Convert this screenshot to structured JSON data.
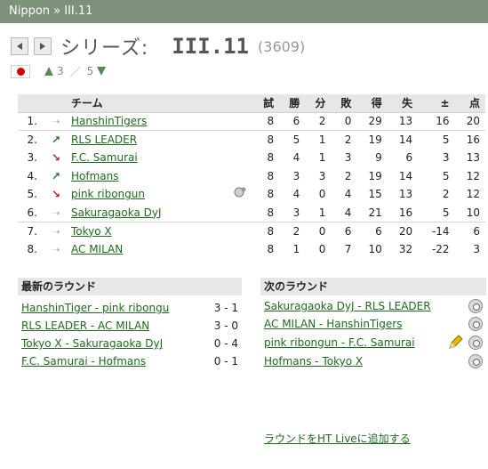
{
  "breadcrumb": "Nippon » III.11",
  "title": {
    "series": "シリーズ:",
    "league": "III.11",
    "id": "(3609)"
  },
  "subnav": {
    "up": "3",
    "sep": "／",
    "down": "5"
  },
  "table": {
    "headers": [
      "チーム",
      "試",
      "勝",
      "分",
      "敗",
      "得",
      "失",
      "±",
      "点"
    ],
    "rows": [
      {
        "pos": "1.",
        "trend": "same",
        "team": "HanshinTigers",
        "p": "8",
        "w": "6",
        "d": "2",
        "l": "0",
        "gf": "29",
        "ga": "13",
        "diff": "16",
        "pts": "20"
      },
      {
        "pos": "2.",
        "trend": "up",
        "team": "RLS LEADER",
        "p": "8",
        "w": "5",
        "d": "1",
        "l": "2",
        "gf": "19",
        "ga": "14",
        "diff": "5",
        "pts": "16"
      },
      {
        "pos": "3.",
        "trend": "down",
        "team": "F.C. Samurai",
        "p": "8",
        "w": "4",
        "d": "1",
        "l": "3",
        "gf": "9",
        "ga": "6",
        "diff": "3",
        "pts": "13"
      },
      {
        "pos": "4.",
        "trend": "up",
        "team": "Hofmans",
        "p": "8",
        "w": "3",
        "d": "3",
        "l": "2",
        "gf": "19",
        "ga": "14",
        "diff": "5",
        "pts": "12"
      },
      {
        "pos": "5.",
        "trend": "down",
        "team": "pink ribongun",
        "p": "8",
        "w": "4",
        "d": "0",
        "l": "4",
        "gf": "15",
        "ga": "13",
        "diff": "2",
        "pts": "12",
        "icon": true
      },
      {
        "pos": "6.",
        "trend": "same",
        "team": "Sakuragaoka DyJ",
        "p": "8",
        "w": "3",
        "d": "1",
        "l": "4",
        "gf": "21",
        "ga": "16",
        "diff": "5",
        "pts": "10"
      },
      {
        "pos": "7.",
        "trend": "same",
        "team": "Tokyo X",
        "p": "8",
        "w": "2",
        "d": "0",
        "l": "6",
        "gf": "6",
        "ga": "20",
        "diff": "-14",
        "pts": "6"
      },
      {
        "pos": "8.",
        "trend": "same",
        "team": "AC MILAN ",
        "p": "8",
        "w": "1",
        "d": "0",
        "l": "7",
        "gf": "10",
        "ga": "32",
        "diff": "-22",
        "pts": "3"
      }
    ]
  },
  "latest": {
    "title": "最新のラウンド",
    "matches": [
      {
        "teams": "HanshinTiger - pink ribongu",
        "score": "3 - 1"
      },
      {
        "teams": "RLS LEADER - AC MILAN ",
        "score": "3 - 0"
      },
      {
        "teams": "Tokyo X - Sakuragaoka DyJ",
        "score": "0 - 4"
      },
      {
        "teams": "F.C. Samurai - Hofmans",
        "score": "0 - 1"
      }
    ]
  },
  "next": {
    "title": "次のラウンド",
    "matches": [
      {
        "teams": "Sakuragaoka DyJ - RLS LEADER"
      },
      {
        "teams": "AC MILAN  - HanshinTigers"
      },
      {
        "teams": "pink ribongun - F.C. Samurai",
        "pencil": true
      },
      {
        "teams": "Hofmans - Tokyo X"
      }
    ],
    "live_link": "ラウンドをHT Liveに追加する"
  }
}
